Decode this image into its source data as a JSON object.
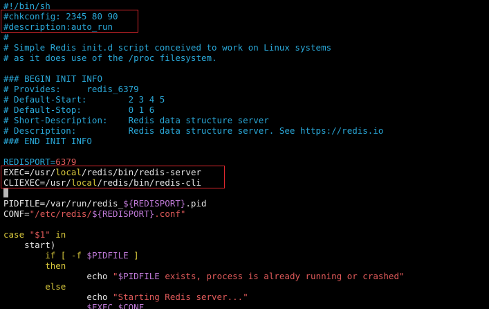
{
  "terminal": {
    "lines": [
      {
        "segments": [
          {
            "text": "#!/bin/sh",
            "cls": "c-comment"
          }
        ]
      },
      {
        "segments": [
          {
            "text": "#chkconfig: 2345 80 90",
            "cls": "c-comment"
          }
        ]
      },
      {
        "segments": [
          {
            "text": "#description:auto_run",
            "cls": "c-comment"
          }
        ]
      },
      {
        "segments": [
          {
            "text": "#",
            "cls": "c-comment"
          }
        ]
      },
      {
        "segments": [
          {
            "text": "# Simple Redis init.d script conceived to work on Linux systems",
            "cls": "c-comment"
          }
        ]
      },
      {
        "segments": [
          {
            "text": "# as it does use of the /proc filesystem.",
            "cls": "c-comment"
          }
        ]
      },
      {
        "segments": [
          {
            "text": "",
            "cls": "c-default"
          }
        ]
      },
      {
        "segments": [
          {
            "text": "### BEGIN INIT INFO",
            "cls": "c-comment"
          }
        ]
      },
      {
        "segments": [
          {
            "text": "# Provides:     redis_6379",
            "cls": "c-comment"
          }
        ]
      },
      {
        "segments": [
          {
            "text": "# Default-Start:        2 3 4 5",
            "cls": "c-comment"
          }
        ]
      },
      {
        "segments": [
          {
            "text": "# Default-Stop:         0 1 6",
            "cls": "c-comment"
          }
        ]
      },
      {
        "segments": [
          {
            "text": "# Short-Description:    Redis data structure server",
            "cls": "c-comment"
          }
        ]
      },
      {
        "segments": [
          {
            "text": "# Description:          Redis data structure server. See https://redis.io",
            "cls": "c-comment"
          }
        ]
      },
      {
        "segments": [
          {
            "text": "### END INIT INFO",
            "cls": "c-comment"
          }
        ]
      },
      {
        "segments": [
          {
            "text": "",
            "cls": "c-default"
          }
        ]
      },
      {
        "segments": [
          {
            "text": "REDISPORT=",
            "cls": "c-comment"
          },
          {
            "text": "6379",
            "cls": "c-num"
          }
        ]
      },
      {
        "segments": [
          {
            "text": "EXEC=/usr/",
            "cls": "c-default"
          },
          {
            "text": "local",
            "cls": "c-path"
          },
          {
            "text": "/redis/bin/redis-server",
            "cls": "c-default"
          }
        ]
      },
      {
        "segments": [
          {
            "text": "CLIEXEC=/usr/",
            "cls": "c-default"
          },
          {
            "text": "local",
            "cls": "c-path"
          },
          {
            "text": "/redis/bin/redis-cli",
            "cls": "c-default"
          }
        ]
      },
      {
        "segments": [
          {
            "text": "",
            "cls": "c-default"
          }
        ]
      },
      {
        "segments": [
          {
            "text": "PIDFILE=/var/run/redis_",
            "cls": "c-default"
          },
          {
            "text": "${REDISPORT}",
            "cls": "c-var"
          },
          {
            "text": ".pid",
            "cls": "c-default"
          }
        ]
      },
      {
        "segments": [
          {
            "text": "CONF=",
            "cls": "c-default"
          },
          {
            "text": "\"/etc/redis/",
            "cls": "c-string"
          },
          {
            "text": "${REDISPORT}",
            "cls": "c-var"
          },
          {
            "text": ".conf\"",
            "cls": "c-string"
          }
        ]
      },
      {
        "segments": [
          {
            "text": "",
            "cls": "c-default"
          }
        ]
      },
      {
        "segments": [
          {
            "text": "case ",
            "cls": "c-keyword"
          },
          {
            "text": "\"$1\"",
            "cls": "c-string"
          },
          {
            "text": " in",
            "cls": "c-keyword"
          }
        ]
      },
      {
        "segments": [
          {
            "text": "    start)",
            "cls": "c-default"
          }
        ]
      },
      {
        "segments": [
          {
            "text": "        if [ -f ",
            "cls": "c-keyword"
          },
          {
            "text": "$PIDFILE",
            "cls": "c-var"
          },
          {
            "text": " ]",
            "cls": "c-keyword"
          }
        ]
      },
      {
        "segments": [
          {
            "text": "        then",
            "cls": "c-keyword"
          }
        ]
      },
      {
        "segments": [
          {
            "text": "                echo ",
            "cls": "c-default"
          },
          {
            "text": "\"",
            "cls": "c-string"
          },
          {
            "text": "$PIDFILE",
            "cls": "c-var"
          },
          {
            "text": " exists, process is already running or crashed\"",
            "cls": "c-string"
          }
        ]
      },
      {
        "segments": [
          {
            "text": "        else",
            "cls": "c-keyword"
          }
        ]
      },
      {
        "segments": [
          {
            "text": "                echo ",
            "cls": "c-default"
          },
          {
            "text": "\"Starting Redis server...\"",
            "cls": "c-string"
          }
        ]
      },
      {
        "segments": [
          {
            "text": "                ",
            "cls": "c-default"
          },
          {
            "text": "$EXEC $CONF",
            "cls": "c-var"
          }
        ]
      }
    ]
  },
  "colors": {
    "background": "#000000",
    "comment": "#2aa8d8",
    "highlight_box": "#e0282e"
  }
}
